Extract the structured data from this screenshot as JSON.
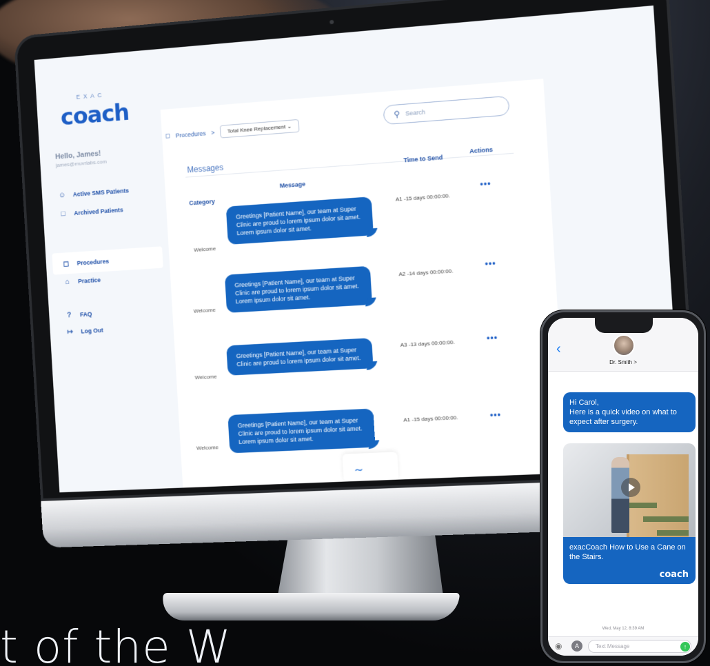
{
  "tagline": "t of the W",
  "app": {
    "logo_top": "EXAC",
    "logo": "coach",
    "greeting": "Hello, James!",
    "email": "james@muvrlabs.com",
    "nav": [
      {
        "label": "Active SMS Patients",
        "icon": "person-icon"
      },
      {
        "label": "Archived Patients",
        "icon": "folder-icon"
      },
      {
        "label": "Procedures",
        "icon": "chat-icon",
        "active": true
      },
      {
        "label": "Practice",
        "icon": "building-icon"
      },
      {
        "label": "FAQ",
        "icon": "question-icon"
      },
      {
        "label": "Log Out",
        "icon": "logout-icon"
      }
    ],
    "breadcrumb": {
      "root": "Procedures",
      "separator": ">",
      "selected": "Total Knee Replacement"
    },
    "search_placeholder": "Search",
    "section_title": "Messages",
    "columns": {
      "category": "Category",
      "message": "Message",
      "time": "Time to Send",
      "actions": "Actions"
    },
    "rows": [
      {
        "category": "Welcome",
        "message": "Greetings [Patient Name], our team at Super Clinic are proud to lorem ipsum dolor sit amet. Lorem ipsum dolor sit amet.",
        "time": "A1 -15 days 00:00:00.",
        "actions": "•••"
      },
      {
        "category": "Welcome",
        "message": "Greetings [Patient Name], our team at Super Clinic are proud to lorem ipsum dolor sit amet. Lorem ipsum dolor sit amet.",
        "time": "A2 -14 days 00:00:00.",
        "actions": "•••"
      },
      {
        "category": "Welcome",
        "message": "Greetings [Patient Name], our team at Super Clinic are proud to lorem ipsum dolor sit amet.",
        "time": "A3 -13 days 00:00:00.",
        "actions": "•••"
      },
      {
        "category": "Welcome",
        "message": "Greetings [Patient Name], our team at Super Clinic are proud to lorem ipsum dolor sit amet. Lorem ipsum dolor sit amet.",
        "time": "A1 -15 days 00:00:00.",
        "actions": "•••"
      }
    ],
    "accent": "#1565c0"
  },
  "phone": {
    "contact": "Dr. Smith >",
    "message": "Hi Carol,\nHere is a quick video on what to expect after surgery.",
    "video_caption": "exacCoach How to Use a Cane on the Stairs.",
    "caption_logo": "coach",
    "timestamp": "Wed, May 12, 8:39 AM",
    "input_placeholder": "Text Message",
    "send_color": "#34c759"
  }
}
